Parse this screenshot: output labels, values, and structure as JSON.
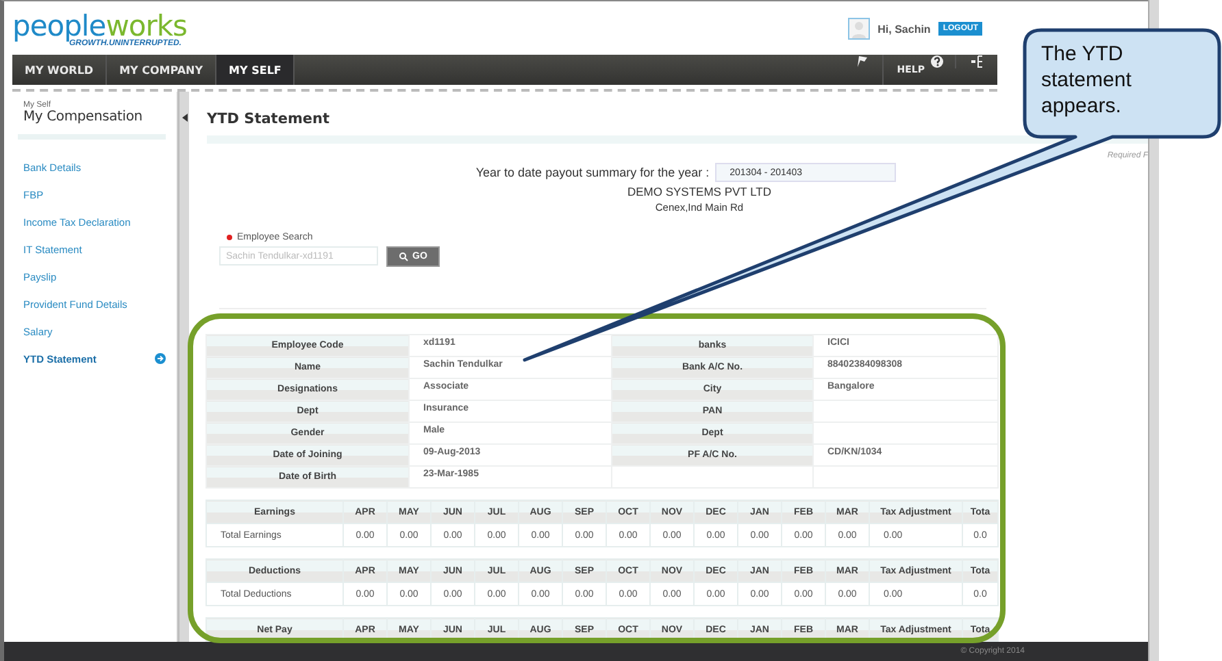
{
  "header": {
    "logo": "peopleworks",
    "tagline": "GROWTH.UNINTERRUPTED.",
    "greeting": "Hi, Sachin",
    "logout": "LOGOUT"
  },
  "nav": {
    "tabs": [
      {
        "label": "MY WORLD",
        "selected": false
      },
      {
        "label": "MY COMPANY",
        "selected": false
      },
      {
        "label": "MY SELF",
        "selected": true
      }
    ],
    "help": "HELP"
  },
  "sidebar": {
    "section": "My Self",
    "title": "My Compensation",
    "items": [
      {
        "label": "Bank Details",
        "selected": false
      },
      {
        "label": "FBP",
        "selected": false
      },
      {
        "label": "Income Tax Declaration",
        "selected": false
      },
      {
        "label": "IT Statement",
        "selected": false
      },
      {
        "label": "Payslip",
        "selected": false
      },
      {
        "label": "Provident Fund Details",
        "selected": false
      },
      {
        "label": "Salary",
        "selected": false
      },
      {
        "label": "YTD Statement",
        "selected": true
      }
    ]
  },
  "content": {
    "title": "YTD Statement",
    "required_note": "Required F",
    "year_label": "Year to date payout summary for the year :",
    "year_select": "201304 - 201403",
    "company": "DEMO SYSTEMS PVT LTD",
    "address": "Cenex,Ind Main Rd",
    "search": {
      "label": "Employee Search",
      "required": true,
      "placeholder": "Sachin Tendulkar-xd1191",
      "button": "GO"
    },
    "details": [
      {
        "label": "Employee Code",
        "value": "xd1191",
        "label_2": "banks",
        "value_2": "ICICI"
      },
      {
        "label": "Name",
        "value": "Sachin Tendulkar",
        "label_2": "Bank A/C No.",
        "value_2": "88402384098308"
      },
      {
        "label": "Designations",
        "value": "Associate",
        "label_2": "City",
        "value_2": "Bangalore"
      },
      {
        "label": "Dept",
        "value": "Insurance",
        "label_2": "PAN"
      },
      {
        "label": "Gender",
        "value": "Male",
        "label_2": "Dept"
      },
      {
        "label": "Date of Joining",
        "value": "09-Aug-2013",
        "label_2": "PF A/C No.",
        "value_2": "CD/KN/1034"
      },
      {
        "label": "Date of Birth",
        "value": "23-Mar-1985"
      }
    ],
    "summaries": [
      {
        "heading": "Earnings",
        "columns": [
          "APR",
          "MAY",
          "JUN",
          "JUL",
          "AUG",
          "SEP",
          "OCT",
          "NOV",
          "DEC",
          "JAN",
          "FEB",
          "MAR",
          "Tax Adjustment",
          "Tota"
        ],
        "rows": [
          {
            "label": "Total Earnings",
            "values": [
              "0.00",
              "0.00",
              "0.00",
              "0.00",
              "0.00",
              "0.00",
              "0.00",
              "0.00",
              "0.00",
              "0.00",
              "0.00",
              "0.00",
              "0.00",
              "0.0"
            ]
          }
        ]
      },
      {
        "heading": "Deductions",
        "columns": [
          "APR",
          "MAY",
          "JUN",
          "JUL",
          "AUG",
          "SEP",
          "OCT",
          "NOV",
          "DEC",
          "JAN",
          "FEB",
          "MAR",
          "Tax Adjustment",
          "Tota"
        ],
        "rows": [
          {
            "label": "Total Deductions",
            "values": [
              "0.00",
              "0.00",
              "0.00",
              "0.00",
              "0.00",
              "0.00",
              "0.00",
              "0.00",
              "0.00",
              "0.00",
              "0.00",
              "0.00",
              "0.00",
              "0.0"
            ]
          }
        ]
      },
      {
        "heading": "Net Pay",
        "columns": [
          "APR",
          "MAY",
          "JUN",
          "JUL",
          "AUG",
          "SEP",
          "OCT",
          "NOV",
          "DEC",
          "JAN",
          "FEB",
          "MAR",
          "Tax Adjustment",
          "Tota"
        ]
      }
    ]
  },
  "footer": {
    "copyright": "© Copyright 2014"
  },
  "callout": {
    "text": "The YTD statement appears."
  }
}
